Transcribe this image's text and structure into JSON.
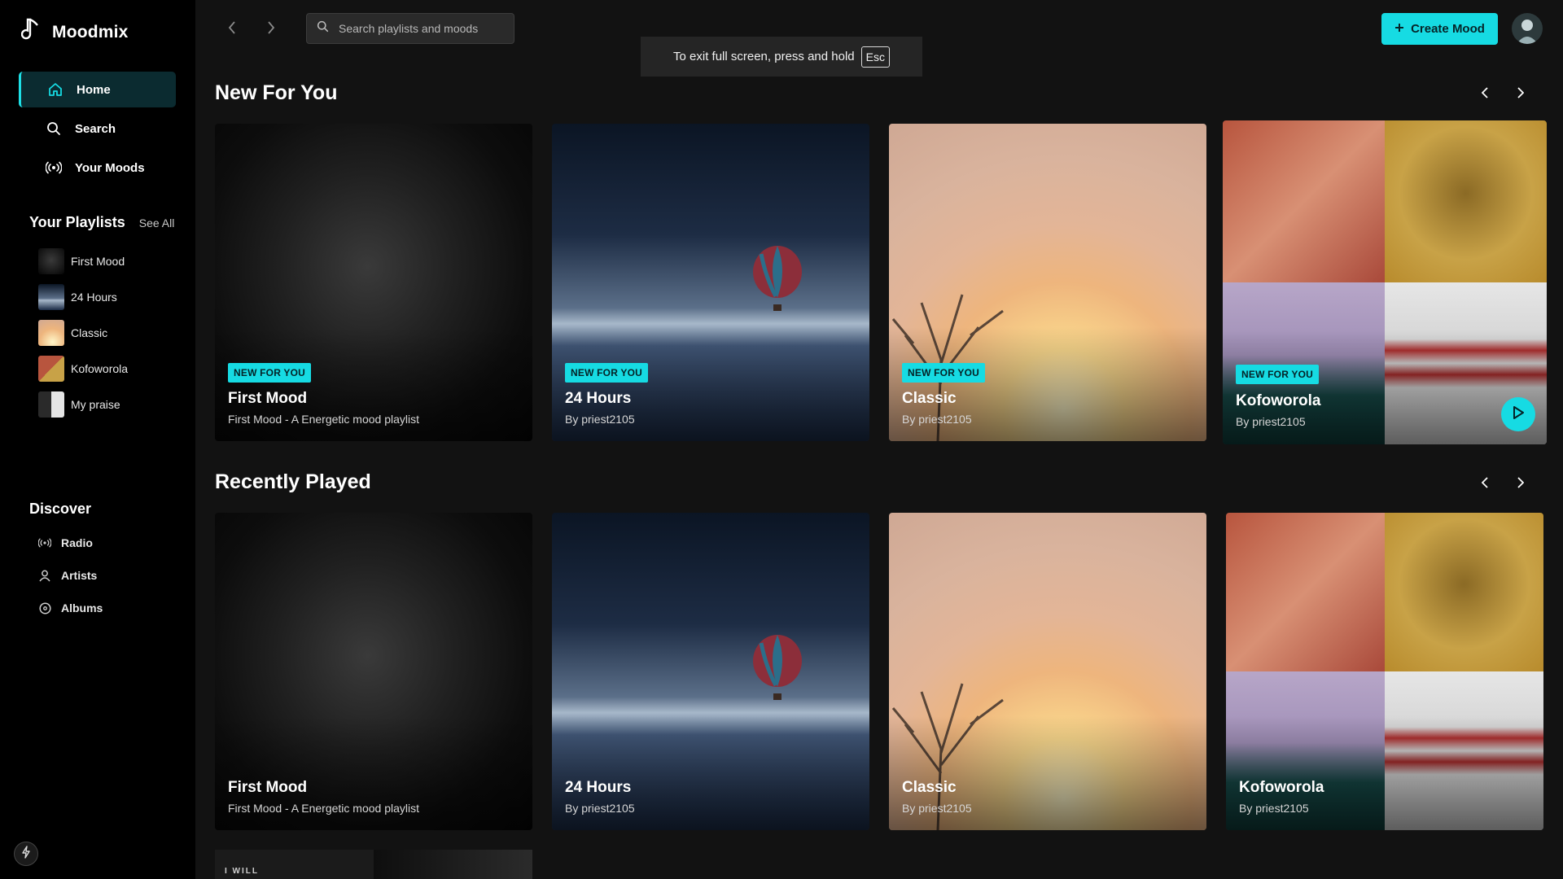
{
  "app": {
    "name": "Moodmix"
  },
  "sidebar": {
    "nav": [
      {
        "label": "Home",
        "icon": "home-icon",
        "active": true
      },
      {
        "label": "Search",
        "icon": "search-icon"
      },
      {
        "label": "Your Moods",
        "icon": "radio-waves-icon"
      }
    ],
    "playlists_heading": "Your Playlists",
    "see_all": "See All",
    "playlists": [
      {
        "label": "First Mood"
      },
      {
        "label": "24 Hours"
      },
      {
        "label": "Classic"
      },
      {
        "label": "Kofoworola"
      },
      {
        "label": "My praise"
      }
    ],
    "discover_heading": "Discover",
    "discover": [
      {
        "label": "Radio",
        "icon": "radio-icon"
      },
      {
        "label": "Artists",
        "icon": "user-icon"
      },
      {
        "label": "Albums",
        "icon": "album-icon"
      }
    ]
  },
  "topbar": {
    "search_placeholder": "Search playlists and moods",
    "create_label": "Create Mood"
  },
  "fullscreen_notice": {
    "text": "To exit full screen, press and hold",
    "key": "Esc"
  },
  "sections": [
    {
      "title": "New For You",
      "cards": [
        {
          "badge": "NEW FOR YOU",
          "title": "First Mood",
          "subtitle": "First Mood - A Energetic mood playlist"
        },
        {
          "badge": "NEW FOR YOU",
          "title": "24 Hours",
          "subtitle": "By priest2105"
        },
        {
          "badge": "NEW FOR YOU",
          "title": "Classic",
          "subtitle": "By priest2105"
        },
        {
          "badge": "NEW FOR YOU",
          "title": "Kofoworola",
          "subtitle": "By priest2105"
        }
      ]
    },
    {
      "title": "Recently Played",
      "cards": [
        {
          "title": "First Mood",
          "subtitle": "First Mood - A Energetic mood playlist"
        },
        {
          "title": "24 Hours",
          "subtitle": "By priest2105"
        },
        {
          "title": "Classic",
          "subtitle": "By priest2105"
        },
        {
          "title": "Kofoworola",
          "subtitle": "By priest2105"
        }
      ]
    }
  ],
  "peek_card": {
    "text": "I WILL"
  },
  "colors": {
    "accent": "#16dbe3",
    "background": "#121212",
    "sidebar": "#000000"
  }
}
